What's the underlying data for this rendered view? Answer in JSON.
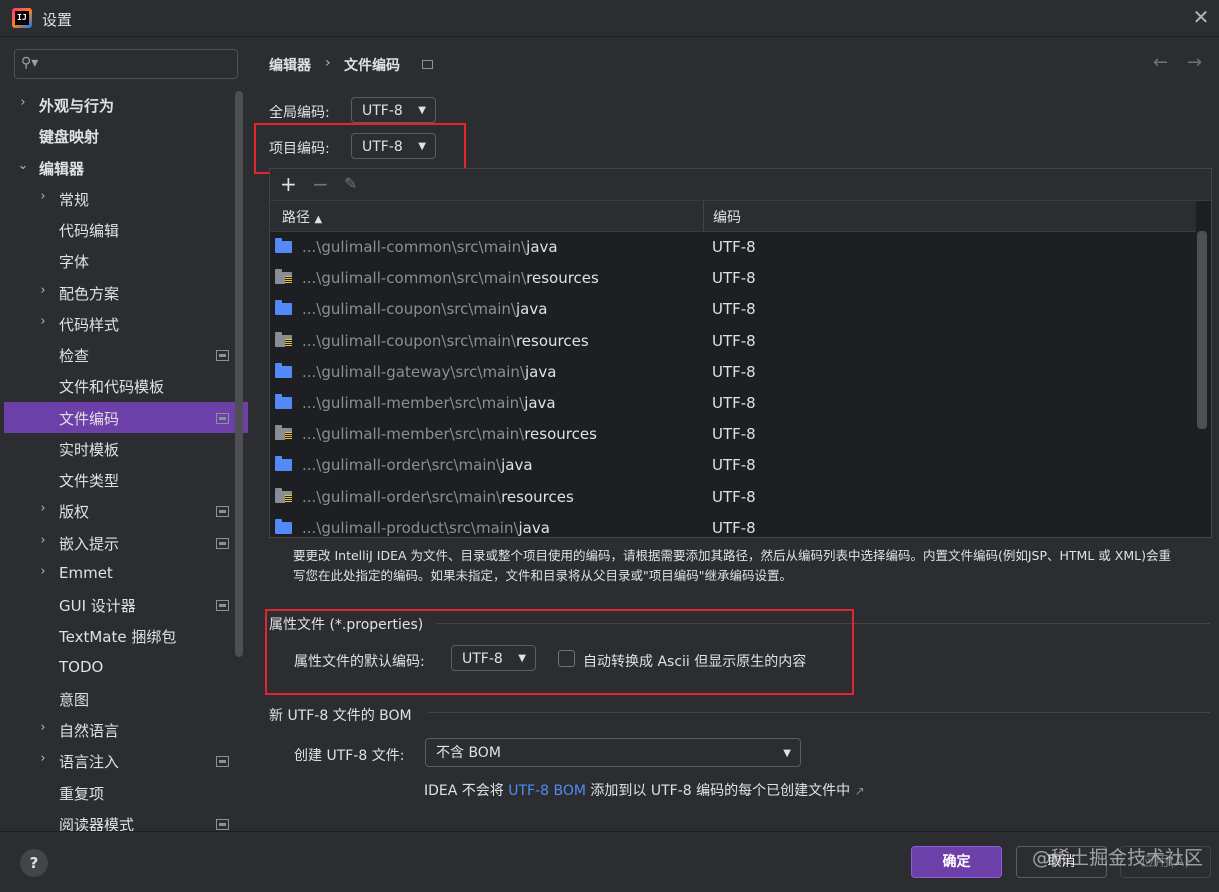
{
  "window": {
    "title": "设置"
  },
  "search": {
    "placeholder": ""
  },
  "sidebar": {
    "items": [
      {
        "label": "外观与行为",
        "chevron": "›",
        "bold": true
      },
      {
        "label": "键盘映射",
        "bold": true
      },
      {
        "label": "编辑器",
        "chevron": "⌄",
        "bold": true
      },
      {
        "label": "常规",
        "chevron": "›"
      },
      {
        "label": "代码编辑"
      },
      {
        "label": "字体"
      },
      {
        "label": "配色方案",
        "chevron": "›"
      },
      {
        "label": "代码样式",
        "chevron": "›"
      },
      {
        "label": "检查",
        "pin": true
      },
      {
        "label": "文件和代码模板"
      },
      {
        "label": "文件编码",
        "pin": true,
        "selected": true
      },
      {
        "label": "实时模板"
      },
      {
        "label": "文件类型"
      },
      {
        "label": "版权",
        "chevron": "›",
        "pin": true
      },
      {
        "label": "嵌入提示",
        "chevron": "›",
        "pin": true
      },
      {
        "label": "Emmet",
        "chevron": "›"
      },
      {
        "label": "GUI 设计器",
        "pin": true
      },
      {
        "label": "TextMate 捆绑包"
      },
      {
        "label": "TODO"
      },
      {
        "label": "意图"
      },
      {
        "label": "自然语言",
        "chevron": "›"
      },
      {
        "label": "语言注入",
        "chevron": "›",
        "pin": true
      },
      {
        "label": "重复项"
      },
      {
        "label": "阅读器模式",
        "pin": true
      }
    ]
  },
  "breadcrumb": {
    "parent": "编辑器",
    "separator": "›",
    "current": "文件编码"
  },
  "global_encoding": {
    "label": "全局编码:",
    "value": "UTF-8"
  },
  "project_encoding": {
    "label": "项目编码:",
    "value": "UTF-8"
  },
  "table": {
    "toolbar": {
      "add": "+",
      "remove": "−",
      "edit": "✎"
    },
    "columns": {
      "path": "路径",
      "sort": "▲",
      "encoding": "编码"
    },
    "rows": [
      {
        "prefix": "...\\gulimall-common\\src\\main\\",
        "folder": "java",
        "type": "source",
        "encoding": "UTF-8"
      },
      {
        "prefix": "...\\gulimall-common\\src\\main\\",
        "folder": "resources",
        "type": "resources",
        "encoding": "UTF-8"
      },
      {
        "prefix": "...\\gulimall-coupon\\src\\main\\",
        "folder": "java",
        "type": "source",
        "encoding": "UTF-8"
      },
      {
        "prefix": "...\\gulimall-coupon\\src\\main\\",
        "folder": "resources",
        "type": "resources",
        "encoding": "UTF-8"
      },
      {
        "prefix": "...\\gulimall-gateway\\src\\main\\",
        "folder": "java",
        "type": "source",
        "encoding": "UTF-8"
      },
      {
        "prefix": "...\\gulimall-member\\src\\main\\",
        "folder": "java",
        "type": "source",
        "encoding": "UTF-8"
      },
      {
        "prefix": "...\\gulimall-member\\src\\main\\",
        "folder": "resources",
        "type": "resources",
        "encoding": "UTF-8"
      },
      {
        "prefix": "...\\gulimall-order\\src\\main\\",
        "folder": "java",
        "type": "source",
        "encoding": "UTF-8"
      },
      {
        "prefix": "...\\gulimall-order\\src\\main\\",
        "folder": "resources",
        "type": "resources",
        "encoding": "UTF-8"
      },
      {
        "prefix": "...\\gulimall-product\\src\\main\\",
        "folder": "java",
        "type": "source",
        "encoding": "UTF-8"
      }
    ]
  },
  "hint": {
    "line1": "要更改 IntelliJ IDEA 为文件、目录或整个项目使用的编码，请根据需要添加其路径，然后从编码列表中选择编码。内置文件编码(例如JSP、HTML 或 XML)会重",
    "line2": "写您在此处指定的编码。如果未指定，文件和目录将从父目录或\"项目编码\"继承编码设置。"
  },
  "properties": {
    "section_title": "属性文件 (*.properties)",
    "default_label": "属性文件的默认编码:",
    "default_value": "UTF-8",
    "ascii_checkbox_label": "自动转换成 Ascii 但显示原生的内容",
    "ascii_checked": false
  },
  "bom": {
    "section_title": "新 UTF-8 文件的 BOM",
    "create_label": "创建 UTF-8 文件:",
    "create_value": "不含 BOM",
    "note_before": "IDEA 不会将 ",
    "note_link": "UTF-8 BOM",
    "note_after": " 添加到以 UTF-8 编码的每个已创建文件中",
    "note_ext": "↗"
  },
  "footer": {
    "help": "?",
    "ok": "确定",
    "cancel": "取消",
    "apply": "应用(A)"
  },
  "watermark": "@稀土掘金技术社区",
  "colors": {
    "accent": "#6d3fa8",
    "link": "#548af7",
    "highlight_box": "#e0262f",
    "bg": "#2b2d30",
    "table_bg": "#1e1f22"
  }
}
